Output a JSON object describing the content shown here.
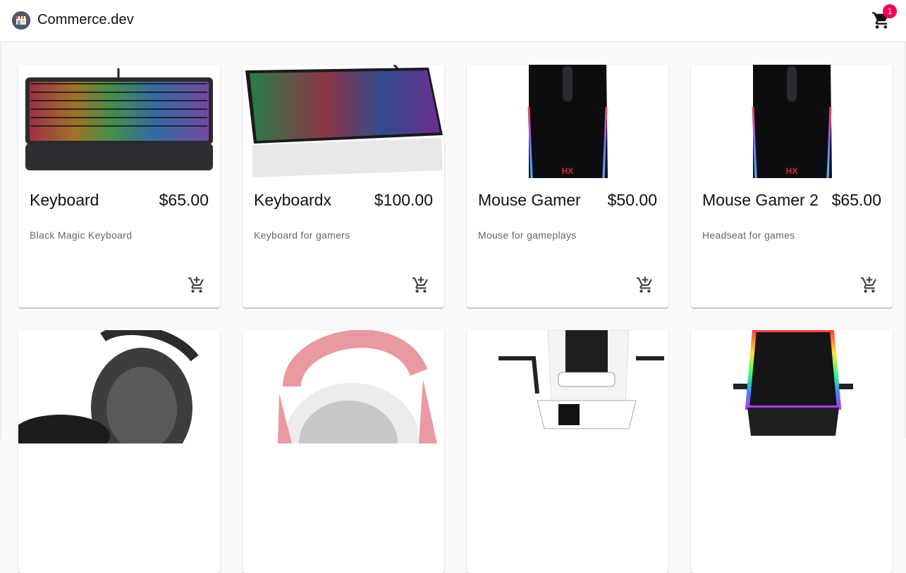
{
  "app": {
    "brand": "Commerce.dev"
  },
  "cart": {
    "count": "1"
  },
  "products": [
    {
      "name": "Keyboard",
      "price": "$65.00",
      "description": "Black Magic Keyboard"
    },
    {
      "name": "Keyboardx",
      "price": "$100.00",
      "description": "Keyboard for gamers"
    },
    {
      "name": "Mouse Gamer",
      "price": "$50.00",
      "description": "Mouse for gameplays"
    },
    {
      "name": "Mouse Gamer 2",
      "price": "$65.00",
      "description": "Headseat for games"
    },
    {
      "name": "",
      "price": "",
      "description": ""
    },
    {
      "name": "",
      "price": "",
      "description": ""
    },
    {
      "name": "",
      "price": "",
      "description": ""
    },
    {
      "name": "",
      "price": "",
      "description": ""
    }
  ],
  "icons": {
    "logo": "store-icon",
    "cart": "shopping-cart-icon",
    "add": "add-shopping-cart-icon"
  },
  "colors": {
    "badge": "#f50057",
    "price_text": "#111111",
    "description_text": "#666666"
  }
}
